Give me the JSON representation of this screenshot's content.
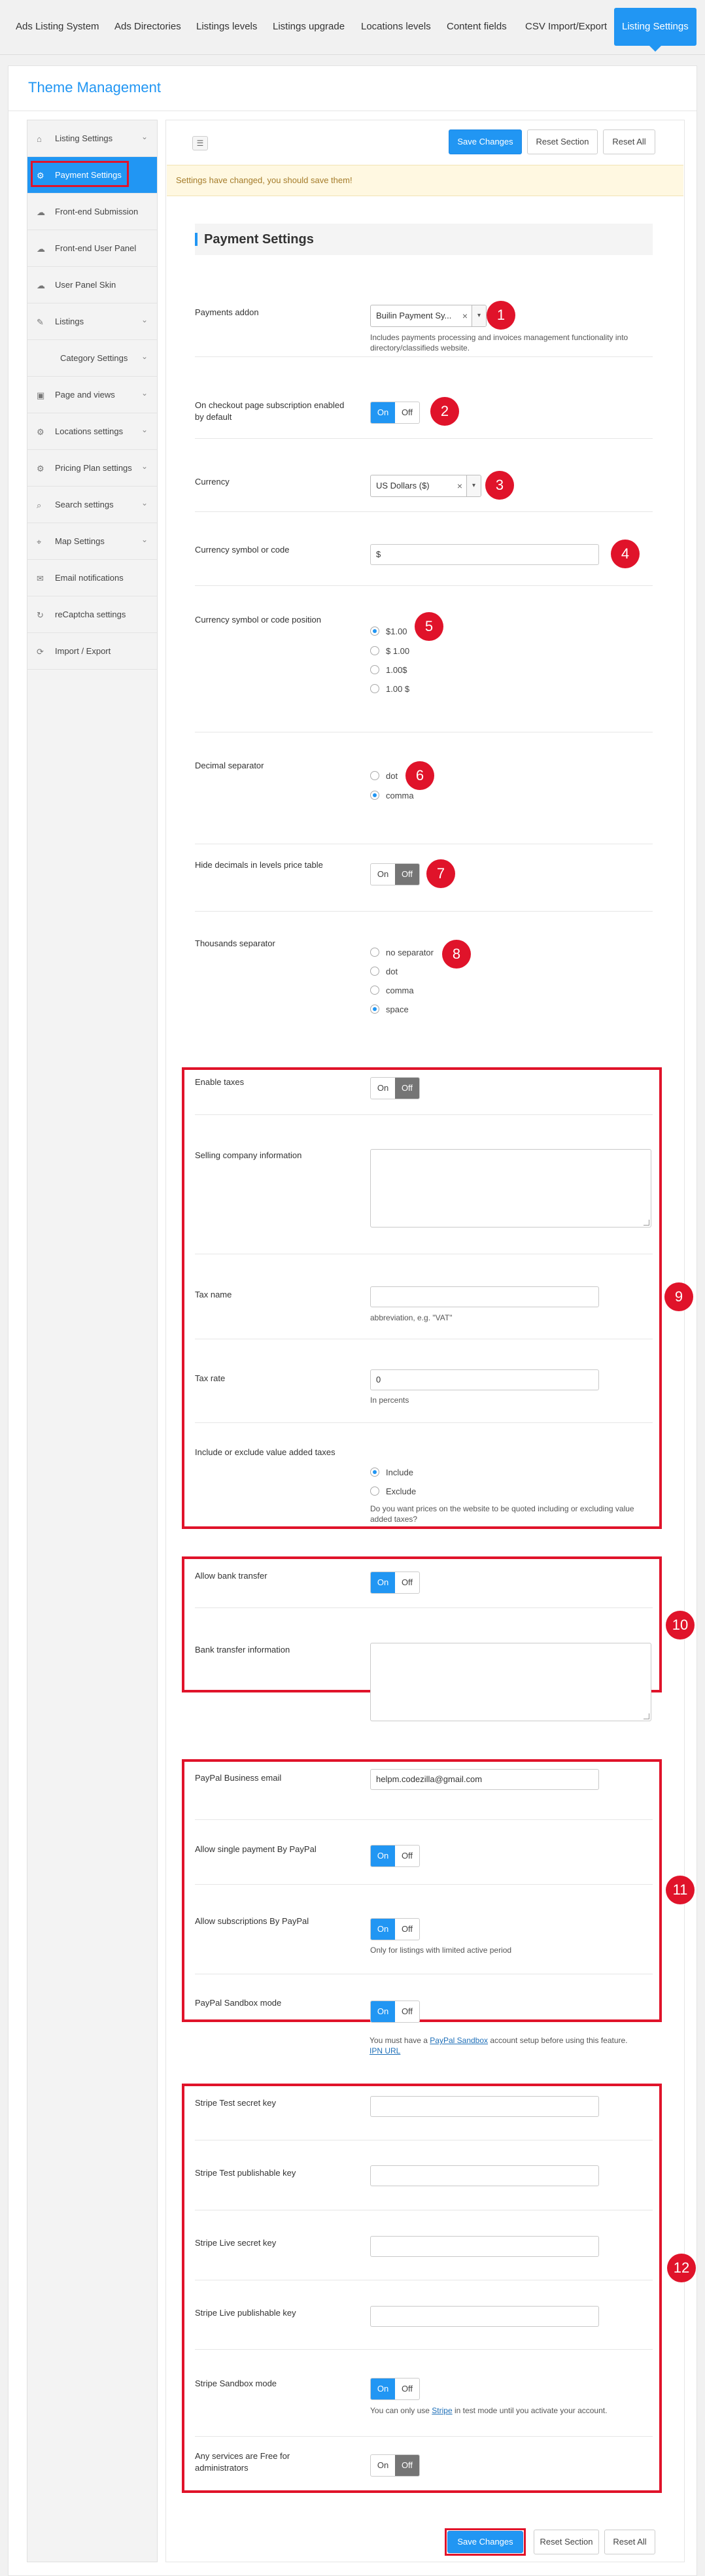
{
  "topnav": {
    "tabs": [
      "Ads Listing System",
      "Ads Directories",
      "Listings levels",
      "Listings upgrade",
      "Locations levels",
      "Content fields",
      "CSV Import/Export",
      "Listing Settings"
    ]
  },
  "page_title": "Theme Management",
  "sidebar": {
    "items": [
      {
        "label": "Listing Settings",
        "icon": "home-icon"
      },
      {
        "label": "Payment Settings",
        "icon": "gear-icon"
      },
      {
        "label": "Front-end Submission",
        "icon": "cloud-icon"
      },
      {
        "label": "Front-end User Panel",
        "icon": "cloud-icon"
      },
      {
        "label": "User Panel Skin",
        "icon": "cloud-icon"
      },
      {
        "label": "Listings",
        "icon": "edit-icon"
      },
      {
        "label": "Category Settings",
        "icon": ""
      },
      {
        "label": "Page and views",
        "icon": "image-icon"
      },
      {
        "label": "Locations settings",
        "icon": "gear-icon"
      },
      {
        "label": "Pricing Plan settings",
        "icon": "gear-icon"
      },
      {
        "label": "Search settings",
        "icon": "search-icon"
      },
      {
        "label": "Map Settings",
        "icon": "map-icon"
      },
      {
        "label": "Email notifications",
        "icon": "mail-icon"
      },
      {
        "label": "reCaptcha settings",
        "icon": "refresh-icon"
      },
      {
        "label": "Import / Export",
        "icon": "sync-icon"
      }
    ]
  },
  "toolbar": {
    "save_label": "Save Changes",
    "reset_section_label": "Reset Section",
    "reset_all_label": "Reset All"
  },
  "notice": "Settings have changed, you should save them!",
  "section_title": "Payment Settings",
  "fields": {
    "payments_addon": {
      "label": "Payments addon",
      "value": "Builin Payment Sy...",
      "help": "Includes payments processing and invoices management functionality into directory/classifieds website."
    },
    "checkout_subscription": {
      "label": "On checkout page subscription enabled by default",
      "state": "on"
    },
    "currency": {
      "label": "Currency",
      "value": "US Dollars ($)"
    },
    "currency_symbol": {
      "label": "Currency symbol or code",
      "value": "$"
    },
    "currency_position": {
      "label": "Currency symbol or code position",
      "options": [
        "$1.00",
        "$ 1.00",
        "1.00$",
        "1.00 $"
      ],
      "selected": 0
    },
    "decimal_separator": {
      "label": "Decimal separator",
      "options": [
        "dot",
        "comma"
      ],
      "selected": 1
    },
    "hide_decimals": {
      "label": "Hide decimals in levels price table",
      "state": "off"
    },
    "thousands_separator": {
      "label": "Thousands separator",
      "options": [
        "no separator",
        "dot",
        "comma",
        "space"
      ],
      "selected": 3
    },
    "enable_taxes": {
      "label": "Enable taxes",
      "state": "off"
    },
    "selling_company": {
      "label": "Selling company information"
    },
    "tax_name": {
      "label": "Tax name",
      "value": "",
      "help": "abbreviation, e.g. \"VAT\""
    },
    "tax_rate": {
      "label": "Tax rate",
      "value": "0",
      "help": "In percents"
    },
    "vat_mode": {
      "label": "Include or exclude value added taxes",
      "options": [
        "Include",
        "Exclude"
      ],
      "selected": 0,
      "help": "Do you want prices on the website to be quoted including or excluding value added taxes?"
    },
    "bank_transfer": {
      "label": "Allow bank transfer",
      "state": "on"
    },
    "bank_transfer_info": {
      "label": "Bank transfer information"
    },
    "paypal_email": {
      "label": "PayPal Business email",
      "value": "helpm.codezilla@gmail.com"
    },
    "paypal_single": {
      "label": "Allow single payment By PayPal",
      "state": "on"
    },
    "paypal_subscriptions": {
      "label": "Allow subscriptions By PayPal",
      "state": "on",
      "help": "Only for listings with limited active period"
    },
    "paypal_sandbox": {
      "label": "PayPal Sandbox mode",
      "state": "on",
      "help_pre": "You must have a ",
      "help_link": "PayPal Sandbox",
      "help_post": " account setup before using this feature.",
      "help_link2": "IPN URL"
    },
    "stripe_test_secret": {
      "label": "Stripe Test secret key",
      "value": ""
    },
    "stripe_test_publishable": {
      "label": "Stripe Test publishable key",
      "value": ""
    },
    "stripe_live_secret": {
      "label": "Stripe Live secret key",
      "value": ""
    },
    "stripe_live_publishable": {
      "label": "Stripe Live publishable key",
      "value": ""
    },
    "stripe_sandbox": {
      "label": "Stripe Sandbox mode",
      "state": "on",
      "help_pre": "You can only use ",
      "help_link": "Stripe",
      "help_post": " in test mode until you activate your account."
    },
    "free_for_admins": {
      "label": "Any services are Free for administrators",
      "state": "off"
    }
  },
  "toggle_labels": {
    "on": "On",
    "off": "Off"
  },
  "badges": [
    "1",
    "2",
    "3",
    "4",
    "5",
    "6",
    "7",
    "8",
    "9",
    "10",
    "11",
    "12"
  ],
  "colors": {
    "accent": "#2196f3",
    "highlight": "#e0132a",
    "notice_bg": "#fff8e1"
  }
}
